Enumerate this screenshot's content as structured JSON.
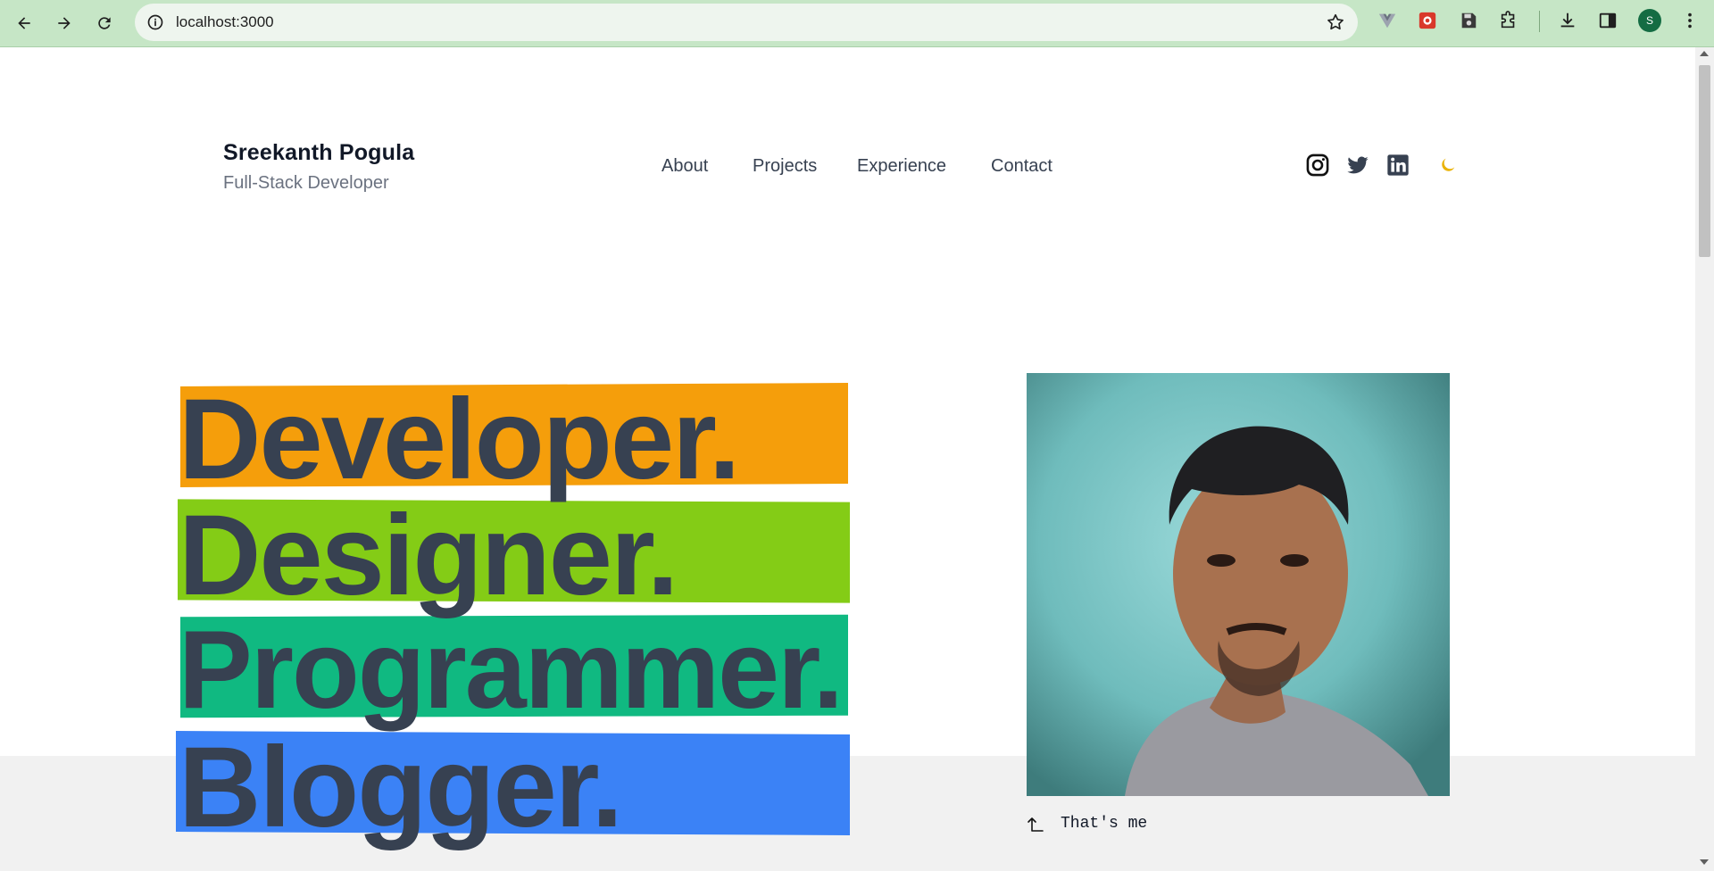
{
  "browser": {
    "url": "localhost:3000",
    "profile_initial": "S",
    "icons": [
      "back-icon",
      "forward-icon",
      "reload-icon",
      "site-info-icon",
      "bookmark-star-icon",
      "vue-devtools-icon",
      "extension-icon",
      "save-icon",
      "puzzle-extensions-icon",
      "download-icon",
      "side-panel-icon",
      "kebab-menu-icon"
    ]
  },
  "header": {
    "name": "Sreekanth Pogula",
    "role": "Full-Stack Developer",
    "nav": [
      "About",
      "Projects",
      "Experience",
      "Contact"
    ],
    "social_icons": [
      "instagram-icon",
      "twitter-icon",
      "linkedin-icon",
      "moon-icon"
    ]
  },
  "hero": {
    "words": [
      {
        "text": "Developer.",
        "color": "#f59e0b"
      },
      {
        "text": "Designer.",
        "color": "#84cc16"
      },
      {
        "text": "Programmer.",
        "color": "#10b981"
      },
      {
        "text": "Blogger.",
        "color": "#3b82f6"
      }
    ],
    "caption": "That's me"
  },
  "colors": {
    "chrome": "#c6e6c6",
    "text_dark": "#374151",
    "moon": "#eab308"
  }
}
